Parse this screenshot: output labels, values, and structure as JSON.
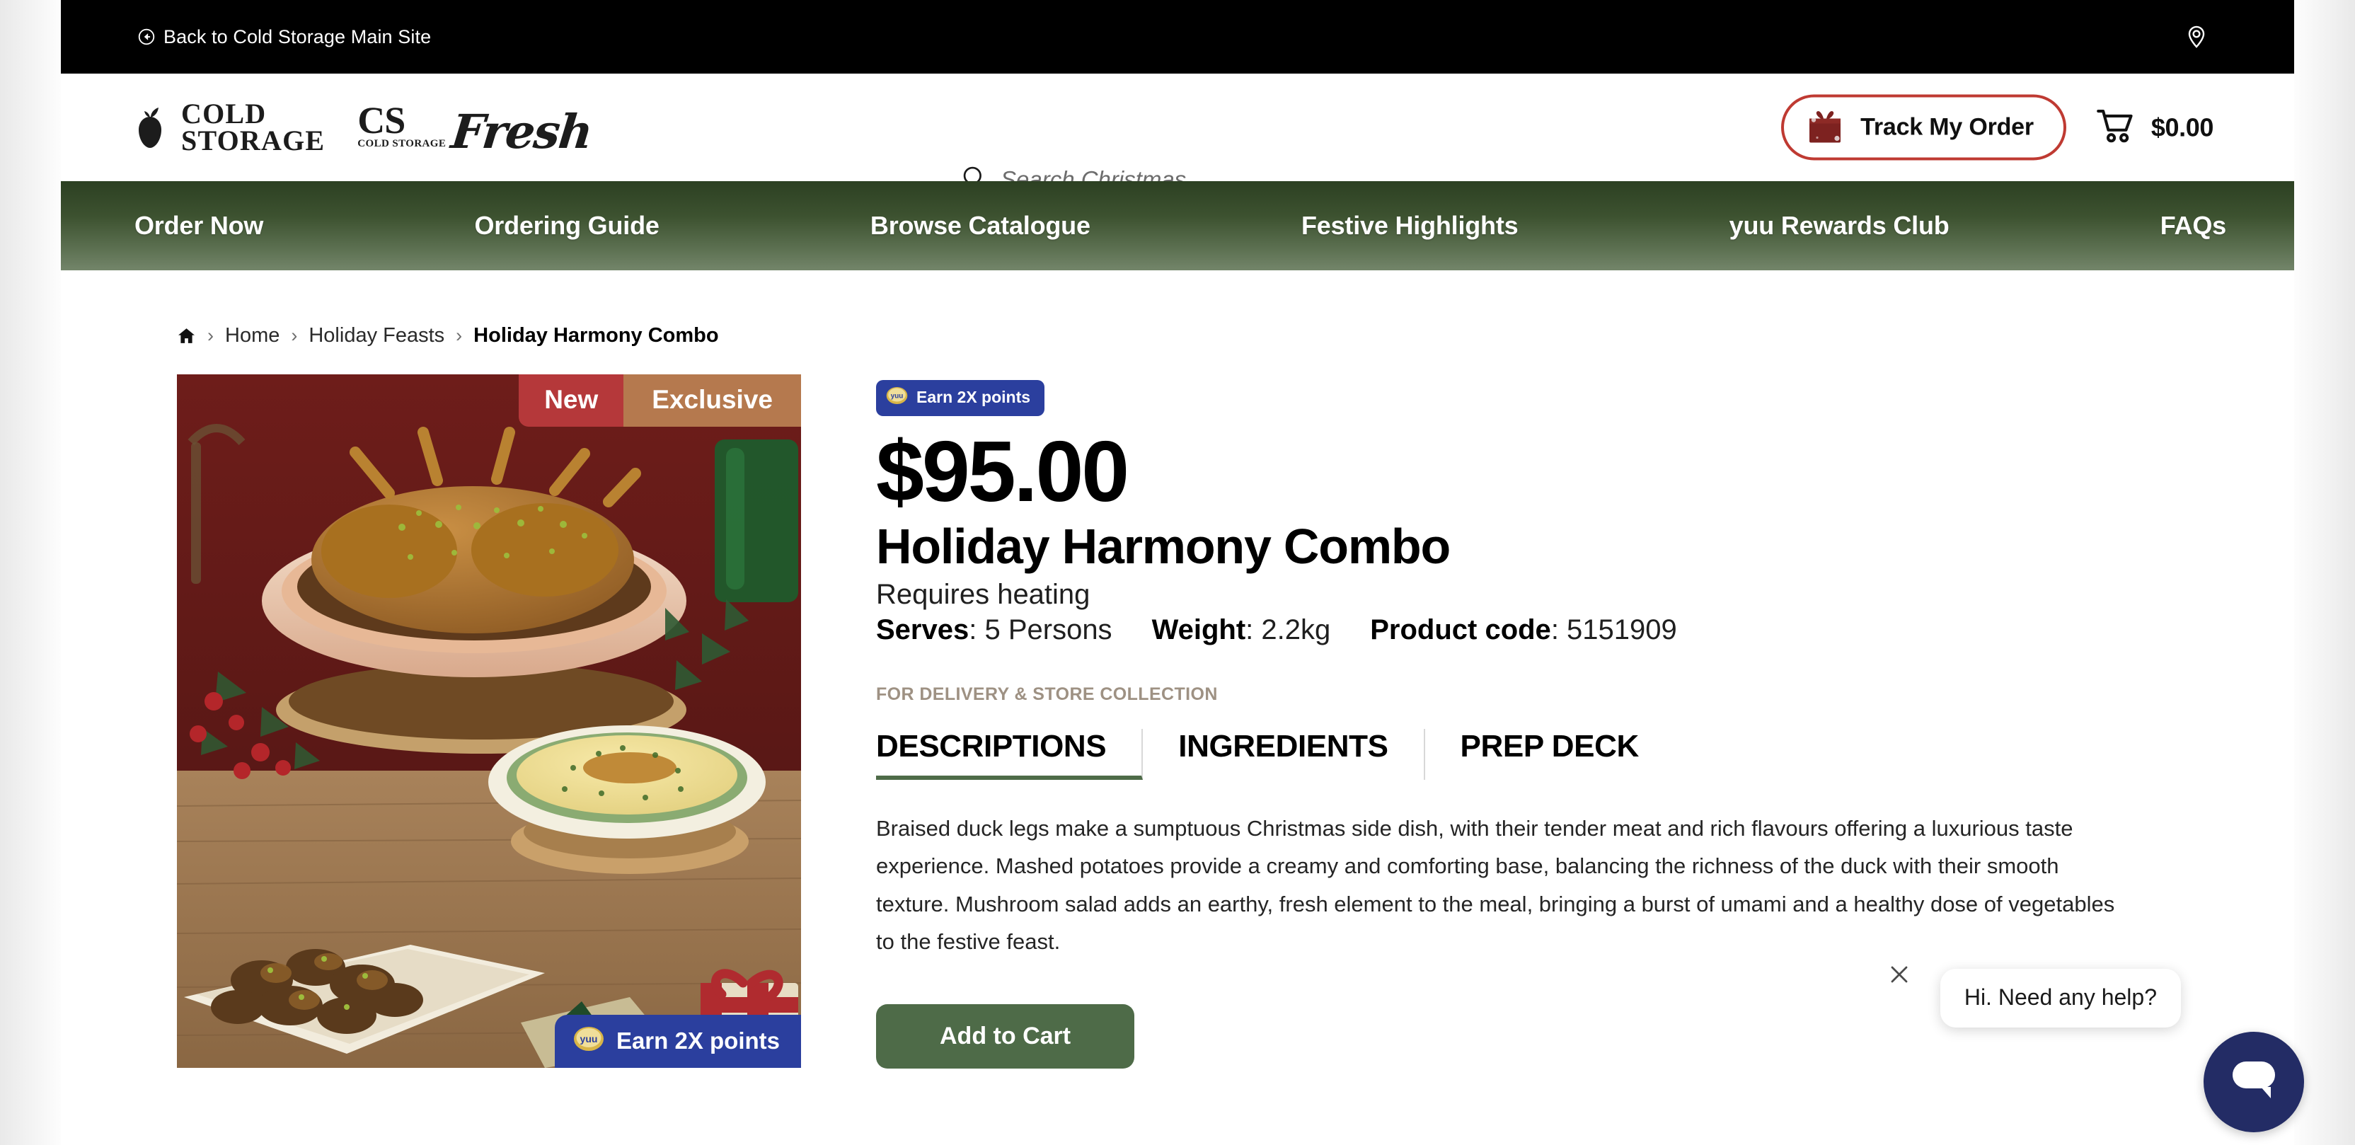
{
  "topbar": {
    "back_label": "Back to Cold Storage Main Site",
    "back_icon": "back-arrow-circle-icon",
    "location_icon": "location-pin-icon"
  },
  "header": {
    "logo": {
      "apple_icon": "apple-logo-icon",
      "line1": "COLD",
      "line2": "STORAGE",
      "fresh_cs": "CS",
      "fresh_sub": "COLD STORAGE",
      "fresh_script": "Fresh"
    },
    "search": {
      "icon": "search-icon",
      "placeholder": "Search Christmas",
      "value": ""
    },
    "track_order": {
      "label": "Track My Order",
      "icon": "gift-box-icon",
      "border_color": "#bf3a32"
    },
    "cart": {
      "icon": "shopping-cart-icon",
      "total": "$0.00"
    }
  },
  "nav": {
    "gradient_top": "#2c4022",
    "gradient_bottom": "#73856a",
    "items": [
      {
        "label": "Order Now"
      },
      {
        "label": "Ordering Guide"
      },
      {
        "label": "Browse Catalogue"
      },
      {
        "label": "Festive Highlights"
      },
      {
        "label": "yuu Rewards Club"
      },
      {
        "label": "FAQs"
      }
    ]
  },
  "breadcrumb": {
    "home_icon": "home-icon",
    "separator": "›",
    "items": [
      {
        "label": "Home"
      },
      {
        "label": "Holiday Feasts"
      },
      {
        "label": "Holiday Harmony Combo"
      }
    ]
  },
  "gallery": {
    "alt": "Braised duck legs in a ceramic dish with mashed potatoes and mushroom salad on a festive wooden table",
    "badge_new": "New",
    "badge_new_color": "#b5383a",
    "badge_exclusive": "Exclusive",
    "badge_exclusive_color": "#b5794e",
    "badge_points": "Earn 2X points",
    "badge_points_color": "#2b3f9e",
    "yuu_icon": "yuu-coin-icon"
  },
  "product": {
    "points_badge": "Earn 2X points",
    "price": "$95.00",
    "title": "Holiday Harmony Combo",
    "heating_note": "Requires heating",
    "serves_label": "Serves",
    "serves_value": ": 5 Persons",
    "weight_label": "Weight",
    "weight_value": ": 2.2kg",
    "code_label": "Product code",
    "code_value": ": 5151909",
    "delivery_note": "FOR DELIVERY & STORE COLLECTION",
    "tabs": [
      {
        "label": "DESCRIPTIONS",
        "active": true
      },
      {
        "label": "INGREDIENTS",
        "active": false
      },
      {
        "label": "PREP DECK",
        "active": false
      }
    ],
    "description": "Braised duck legs make a sumptuous Christmas side dish, with their tender meat and rich flavours offering a luxurious taste experience. Mashed potatoes provide a creamy and comforting base, balancing the richness of the duck with their smooth texture. Mushroom salad adds an earthy, fresh element to the meal, bringing a burst of umami and a healthy dose of vegetables to the festive feast.",
    "cta_label": "Add to Cart",
    "cta_color": "#4e6b48"
  },
  "chat": {
    "message": "Hi. Need any help?",
    "close_icon": "close-icon",
    "launcher_icon": "chat-bubble-icon",
    "launcher_color": "#232c65"
  }
}
